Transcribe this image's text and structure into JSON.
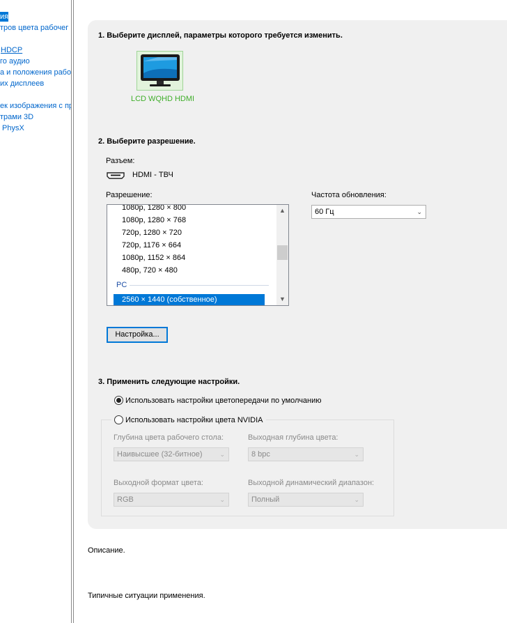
{
  "sidebar": {
    "items": [
      {
        "label": "ия",
        "selected": true
      },
      {
        "label": "тров цвета рабочег"
      },
      {
        "label": "HDCP",
        "underlined": true
      },
      {
        "label": "го аудио"
      },
      {
        "label": "а и положения рабо"
      },
      {
        "label": "их дисплеев"
      },
      {
        "label": "ек изображения с пр"
      },
      {
        "label": "трами 3D"
      },
      {
        "label": "PhysX"
      }
    ]
  },
  "section1": {
    "title": "1. Выберите дисплей, параметры которого требуется изменить.",
    "display": {
      "label": "LCD WQHD HDMI",
      "icon": "monitor-icon"
    }
  },
  "section2": {
    "title": "2. Выберите разрешение.",
    "connector_label": "Разъем:",
    "connector_value": "HDMI - ТВЧ",
    "resolution_label": "Разрешение:",
    "resolutions": [
      "1080p, 1280 × 800",
      "1080p, 1280 × 768",
      "720p, 1280 × 720",
      "720p, 1176 × 664",
      "1080p, 1152 × 864",
      "480p, 720 × 480"
    ],
    "pc_group": "PC",
    "selected_resolution": "2560 × 1440 (собственное)",
    "refresh_label": "Частота обновления:",
    "refresh_value": "60 Гц",
    "customize_button": "Настройка..."
  },
  "section3": {
    "title": "3. Применить следующие настройки.",
    "option_default": "Использовать настройки цветопередачи по умолчанию",
    "option_nvidia": "Использовать настройки цвета NVIDIA",
    "desktop_depth_label": "Глубина цвета рабочего стола:",
    "desktop_depth_value": "Наивысшее (32-битное)",
    "output_depth_label": "Выходная глубина цвета:",
    "output_depth_value": "8 bpc",
    "output_format_label": "Выходной формат цвета:",
    "output_format_value": "RGB",
    "dynamic_range_label": "Выходной динамический диапазон:",
    "dynamic_range_value": "Полный"
  },
  "footer": {
    "description": "Описание.",
    "typical_usage": "Типичные ситуации применения."
  },
  "colors": {
    "accent": "#0078d7",
    "link": "#0066cc",
    "display_green": "#3fae2a",
    "panel_bg": "#f0f0f0"
  }
}
